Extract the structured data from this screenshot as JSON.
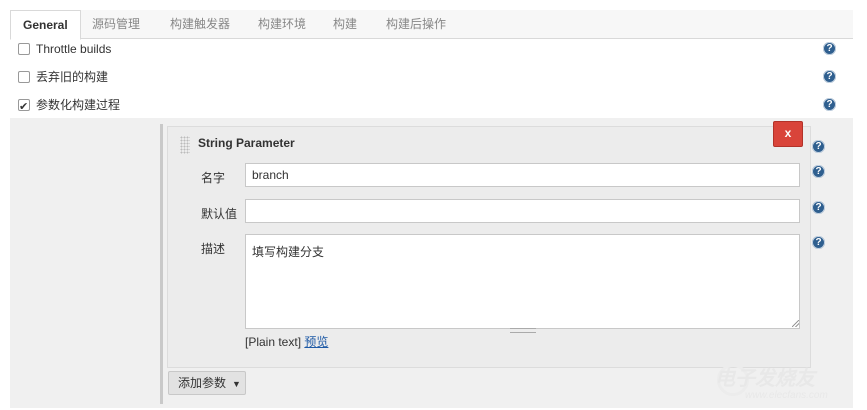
{
  "tabs": [
    {
      "label": "General",
      "active": true
    },
    {
      "label": "源码管理",
      "active": false
    },
    {
      "label": "构建触发器",
      "active": false
    },
    {
      "label": "构建环境",
      "active": false
    },
    {
      "label": "构建",
      "active": false
    },
    {
      "label": "构建后操作",
      "active": false
    }
  ],
  "options": [
    {
      "label": "Throttle builds",
      "checked": false
    },
    {
      "label": "丢弃旧的构建",
      "checked": false
    },
    {
      "label": "参数化构建过程",
      "checked": true
    }
  ],
  "help_glyph": "?",
  "parameter": {
    "title": "String Parameter",
    "delete_label": "x",
    "name_label": "名字",
    "name_value": "branch",
    "default_label": "默认值",
    "default_value": "",
    "description_label": "描述",
    "description_value": "填写构建分支",
    "plain_text": "[Plain text]",
    "preview_link": "预览"
  },
  "add_param_label": "添加参数",
  "watermark": {
    "main": "电子发烧友",
    "sub": "www.elecfans.com"
  },
  "colors": {
    "delete": "#d9443a",
    "help": "#2f5f8f",
    "link": "#1f5aa6"
  }
}
